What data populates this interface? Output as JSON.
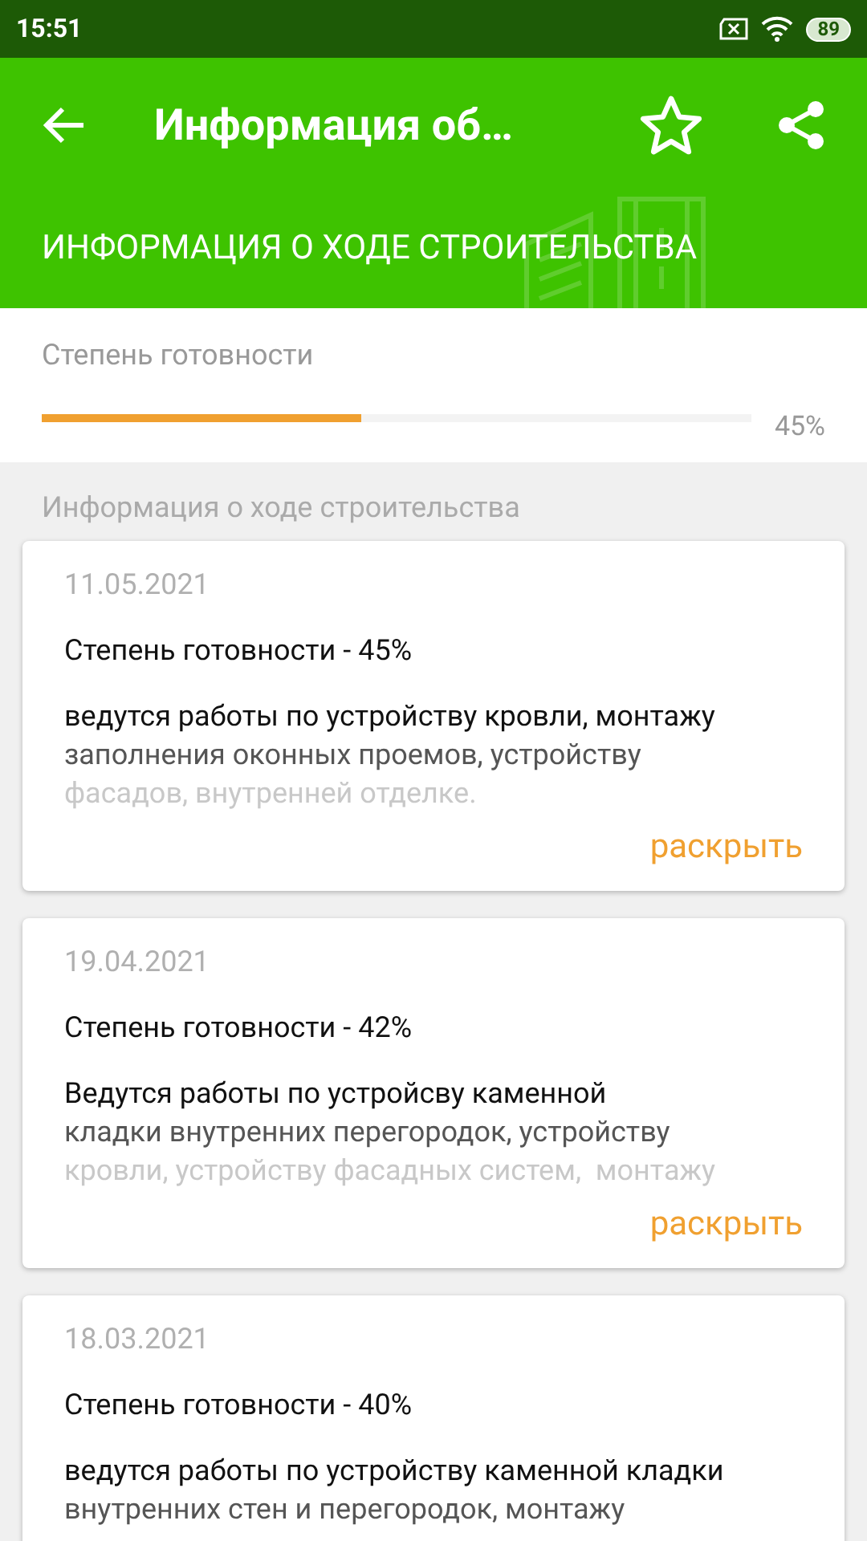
{
  "status_bar": {
    "time": "15:51",
    "battery": "89"
  },
  "toolbar": {
    "title": "Информация об…"
  },
  "header": {
    "title": "ИНФОРМАЦИЯ О ХОДЕ СТРОИТЕЛЬСТВА"
  },
  "readiness": {
    "label": "Степень готовности",
    "level": 0.45,
    "reading": "45%"
  },
  "section_title": "Информация о ходе строительства",
  "entries": [
    {
      "date": "11.05.2021",
      "readiness": "Степень готовности - 45%",
      "lines": [
        "ведутся работы по устройству кровли, монтажу",
        "заполнения оконных проемов, устройству",
        "фасадов, внутренней отделке."
      ],
      "action": "раскрыть"
    },
    {
      "date": "19.04.2021",
      "readiness": "Степень готовности - 42%",
      "lines": [
        "Ведутся работы по устройсву каменной",
        "кладки внутренних перегородок, устройству",
        "кровли, устройству фасадных систем,  монтажу"
      ],
      "action": "раскрыть"
    },
    {
      "date": "18.03.2021",
      "readiness": "Степень готовности - 40%",
      "lines": [
        "ведутся работы по устройству каменной кладки",
        "внутренних стен и перегородок, монтажу"
      ]
    }
  ]
}
